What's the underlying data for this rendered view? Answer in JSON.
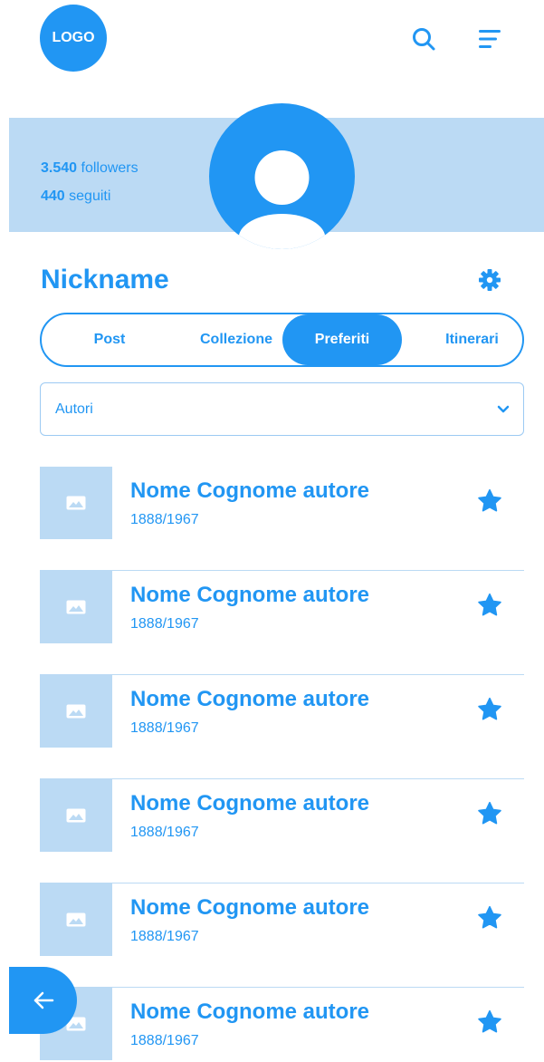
{
  "header": {
    "logo_text": "LOGO",
    "search_icon": "search-icon",
    "menu_icon": "menu-icon"
  },
  "profile": {
    "followers_count": "3.540",
    "followers_label": "followers",
    "following_count": "440",
    "following_label": "seguiti",
    "nickname": "Nickname",
    "avatar_icon": "user-avatar-icon",
    "settings_icon": "gear-icon"
  },
  "tabs": [
    {
      "label": "Post",
      "active": false
    },
    {
      "label": "Collezione",
      "active": false
    },
    {
      "label": "Preferiti",
      "active": true
    },
    {
      "label": "Itinerari",
      "active": false
    }
  ],
  "filter": {
    "selected": "Autori",
    "icon": "chevron-down-icon"
  },
  "items": [
    {
      "name": "Nome Cognome autore",
      "years": "1888/1967",
      "favorite": true
    },
    {
      "name": "Nome Cognome autore",
      "years": "1888/1967",
      "favorite": true
    },
    {
      "name": "Nome Cognome autore",
      "years": "1888/1967",
      "favorite": true
    },
    {
      "name": "Nome Cognome autore",
      "years": "1888/1967",
      "favorite": true
    },
    {
      "name": "Nome Cognome autore",
      "years": "1888/1967",
      "favorite": true
    },
    {
      "name": "Nome Cognome autore",
      "years": "1888/1967",
      "favorite": true
    }
  ],
  "colors": {
    "primary": "#2196f3",
    "light": "#bbdaf4"
  },
  "back_icon": "arrow-left-icon"
}
